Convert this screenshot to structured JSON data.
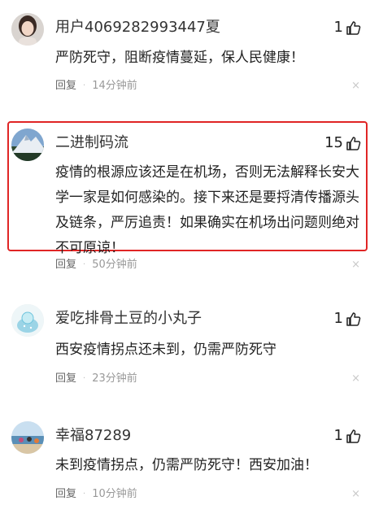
{
  "comments": [
    {
      "username": "用户4069282993447夏",
      "likes": "1",
      "text": "严防死守，阻断疫情蔓延，保人民健康！",
      "reply_label": "回复",
      "separator": "·",
      "time": "14分钟前",
      "avatar_icon": "avatar-woman-photo"
    },
    {
      "username": "二进制码流",
      "likes": "15",
      "text": "疫情的根源应该还是在机场，否则无法解释长安大学一家是如何感染的。接下来还是要捋清传播源头及链条，严厉追责！如果确实在机场出问题则绝对不可原谅！",
      "reply_label": "回复",
      "separator": "·",
      "time": "50分钟前",
      "avatar_icon": "avatar-mountain-photo",
      "highlighted": true,
      "highlight_color": "#e02525"
    },
    {
      "username": "爱吃排骨土豆的小丸子",
      "likes": "1",
      "text": "西安疫情拐点还未到，仍需严防死守",
      "reply_label": "回复",
      "separator": "·",
      "time": "23分钟前",
      "avatar_icon": "avatar-cartoon-blue"
    },
    {
      "username": "幸福87289",
      "likes": "1",
      "text": "未到疫情拐点，仍需严防死守！西安加油！",
      "reply_label": "回复",
      "separator": "·",
      "time": "10分钟前",
      "avatar_icon": "avatar-beach-photo"
    }
  ],
  "close_glyph": "×",
  "like_icon": "thumbs-up-icon"
}
